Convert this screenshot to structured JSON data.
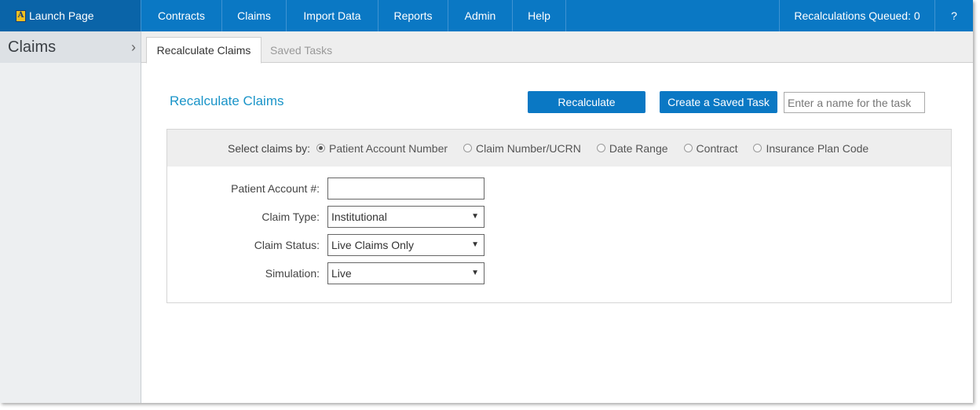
{
  "topnav": {
    "launch_label": "Launch Page",
    "logo_letter": "A",
    "items": [
      "Contracts",
      "Claims",
      "Import Data",
      "Reports",
      "Admin",
      "Help"
    ],
    "queued_label": "Recalculations Queued: 0",
    "help_label": "?"
  },
  "sidebar": {
    "title": "Claims",
    "chevron": "›"
  },
  "tabs": [
    {
      "label": "Recalculate Claims",
      "active": true
    },
    {
      "label": "Saved Tasks",
      "active": false
    }
  ],
  "main": {
    "title": "Recalculate Claims",
    "recalculate_label": "Recalculate",
    "create_task_label": "Create a Saved Task",
    "task_name_placeholder": "Enter a name for the task",
    "task_name_value": ""
  },
  "selector": {
    "label": "Select claims by:",
    "options": [
      "Patient Account Number",
      "Claim Number/UCRN",
      "Date Range",
      "Contract",
      "Insurance Plan Code"
    ],
    "selected_index": 0
  },
  "form": {
    "patient_account_label": "Patient Account #:",
    "patient_account_value": "",
    "claim_type_label": "Claim Type:",
    "claim_type_value": "Institutional",
    "claim_status_label": "Claim Status:",
    "claim_status_value": "Live Claims Only",
    "simulation_label": "Simulation:",
    "simulation_value": "Live"
  },
  "colors": {
    "nav_blue": "#0a78c4",
    "launch_blue": "#0a64a8",
    "title_blue": "#1a94c8"
  }
}
